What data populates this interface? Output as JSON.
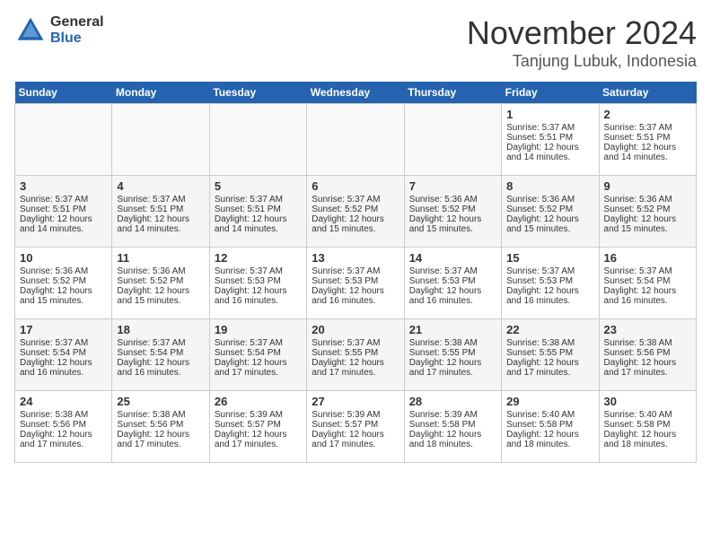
{
  "logo": {
    "general": "General",
    "blue": "Blue"
  },
  "title": "November 2024",
  "location": "Tanjung Lubuk, Indonesia",
  "days_header": [
    "Sunday",
    "Monday",
    "Tuesday",
    "Wednesday",
    "Thursday",
    "Friday",
    "Saturday"
  ],
  "weeks": [
    [
      {
        "day": "",
        "info": ""
      },
      {
        "day": "",
        "info": ""
      },
      {
        "day": "",
        "info": ""
      },
      {
        "day": "",
        "info": ""
      },
      {
        "day": "",
        "info": ""
      },
      {
        "day": "1",
        "info": "Sunrise: 5:37 AM\nSunset: 5:51 PM\nDaylight: 12 hours and 14 minutes."
      },
      {
        "day": "2",
        "info": "Sunrise: 5:37 AM\nSunset: 5:51 PM\nDaylight: 12 hours and 14 minutes."
      }
    ],
    [
      {
        "day": "3",
        "info": "Sunrise: 5:37 AM\nSunset: 5:51 PM\nDaylight: 12 hours and 14 minutes."
      },
      {
        "day": "4",
        "info": "Sunrise: 5:37 AM\nSunset: 5:51 PM\nDaylight: 12 hours and 14 minutes."
      },
      {
        "day": "5",
        "info": "Sunrise: 5:37 AM\nSunset: 5:51 PM\nDaylight: 12 hours and 14 minutes."
      },
      {
        "day": "6",
        "info": "Sunrise: 5:37 AM\nSunset: 5:52 PM\nDaylight: 12 hours and 15 minutes."
      },
      {
        "day": "7",
        "info": "Sunrise: 5:36 AM\nSunset: 5:52 PM\nDaylight: 12 hours and 15 minutes."
      },
      {
        "day": "8",
        "info": "Sunrise: 5:36 AM\nSunset: 5:52 PM\nDaylight: 12 hours and 15 minutes."
      },
      {
        "day": "9",
        "info": "Sunrise: 5:36 AM\nSunset: 5:52 PM\nDaylight: 12 hours and 15 minutes."
      }
    ],
    [
      {
        "day": "10",
        "info": "Sunrise: 5:36 AM\nSunset: 5:52 PM\nDaylight: 12 hours and 15 minutes."
      },
      {
        "day": "11",
        "info": "Sunrise: 5:36 AM\nSunset: 5:52 PM\nDaylight: 12 hours and 15 minutes."
      },
      {
        "day": "12",
        "info": "Sunrise: 5:37 AM\nSunset: 5:53 PM\nDaylight: 12 hours and 16 minutes."
      },
      {
        "day": "13",
        "info": "Sunrise: 5:37 AM\nSunset: 5:53 PM\nDaylight: 12 hours and 16 minutes."
      },
      {
        "day": "14",
        "info": "Sunrise: 5:37 AM\nSunset: 5:53 PM\nDaylight: 12 hours and 16 minutes."
      },
      {
        "day": "15",
        "info": "Sunrise: 5:37 AM\nSunset: 5:53 PM\nDaylight: 12 hours and 16 minutes."
      },
      {
        "day": "16",
        "info": "Sunrise: 5:37 AM\nSunset: 5:54 PM\nDaylight: 12 hours and 16 minutes."
      }
    ],
    [
      {
        "day": "17",
        "info": "Sunrise: 5:37 AM\nSunset: 5:54 PM\nDaylight: 12 hours and 16 minutes."
      },
      {
        "day": "18",
        "info": "Sunrise: 5:37 AM\nSunset: 5:54 PM\nDaylight: 12 hours and 16 minutes."
      },
      {
        "day": "19",
        "info": "Sunrise: 5:37 AM\nSunset: 5:54 PM\nDaylight: 12 hours and 17 minutes."
      },
      {
        "day": "20",
        "info": "Sunrise: 5:37 AM\nSunset: 5:55 PM\nDaylight: 12 hours and 17 minutes."
      },
      {
        "day": "21",
        "info": "Sunrise: 5:38 AM\nSunset: 5:55 PM\nDaylight: 12 hours and 17 minutes."
      },
      {
        "day": "22",
        "info": "Sunrise: 5:38 AM\nSunset: 5:55 PM\nDaylight: 12 hours and 17 minutes."
      },
      {
        "day": "23",
        "info": "Sunrise: 5:38 AM\nSunset: 5:56 PM\nDaylight: 12 hours and 17 minutes."
      }
    ],
    [
      {
        "day": "24",
        "info": "Sunrise: 5:38 AM\nSunset: 5:56 PM\nDaylight: 12 hours and 17 minutes."
      },
      {
        "day": "25",
        "info": "Sunrise: 5:38 AM\nSunset: 5:56 PM\nDaylight: 12 hours and 17 minutes."
      },
      {
        "day": "26",
        "info": "Sunrise: 5:39 AM\nSunset: 5:57 PM\nDaylight: 12 hours and 17 minutes."
      },
      {
        "day": "27",
        "info": "Sunrise: 5:39 AM\nSunset: 5:57 PM\nDaylight: 12 hours and 17 minutes."
      },
      {
        "day": "28",
        "info": "Sunrise: 5:39 AM\nSunset: 5:58 PM\nDaylight: 12 hours and 18 minutes."
      },
      {
        "day": "29",
        "info": "Sunrise: 5:40 AM\nSunset: 5:58 PM\nDaylight: 12 hours and 18 minutes."
      },
      {
        "day": "30",
        "info": "Sunrise: 5:40 AM\nSunset: 5:58 PM\nDaylight: 12 hours and 18 minutes."
      }
    ]
  ]
}
